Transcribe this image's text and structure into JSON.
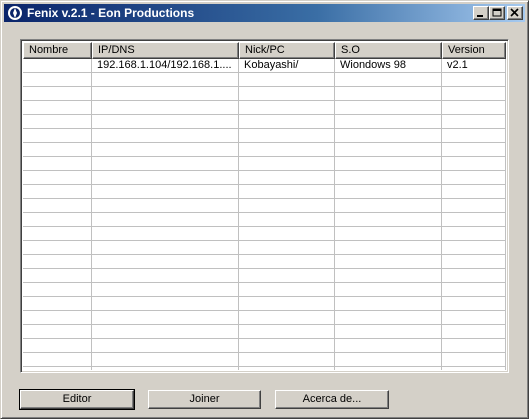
{
  "window": {
    "title": "Fenix v.2.1 - Eon Productions",
    "icon": "app-logo-icon"
  },
  "titlebar_buttons": {
    "minimize": "minimize-icon",
    "maximize": "maximize-icon",
    "close": "close-icon"
  },
  "table": {
    "columns": [
      "Nombre",
      "IP/DNS",
      "Nick/PC",
      "S.O",
      "Version"
    ],
    "rows": [
      [
        "",
        "192.168.1.104/192.168.1....",
        "Kobayashi/",
        "Wiondows 98",
        "v2.1"
      ]
    ]
  },
  "buttons": {
    "editor": "Editor",
    "joiner": "Joiner",
    "acerca": "Acerca de..."
  }
}
